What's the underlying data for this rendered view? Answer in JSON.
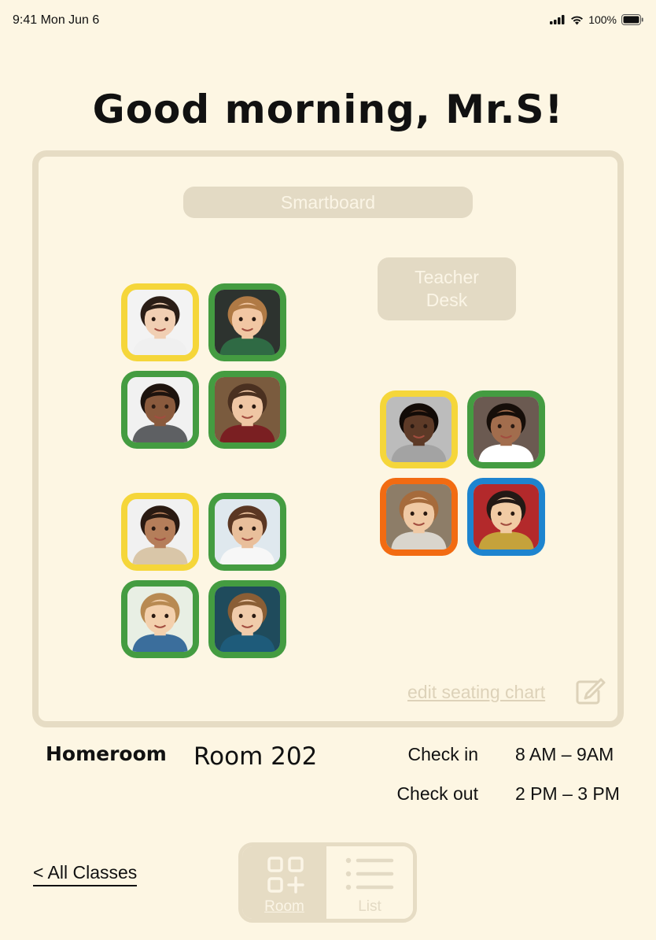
{
  "status_bar": {
    "time": "9:41  Mon Jun 6",
    "battery": "100%"
  },
  "greeting": "Good morning, Mr.S!",
  "room": {
    "smartboard_label": "Smartboard",
    "teacher_desk_label": "Teacher Desk",
    "edit_link": "edit seating chart",
    "students": [
      {
        "status_color": "#f5d63a",
        "skin": "#f1cfb3",
        "hair": "#2a1d16",
        "shirt": "#f0f0f0",
        "bg": "#f3f3f3"
      },
      {
        "status_color": "#449c41",
        "skin": "#f2c7a3",
        "hair": "#b07a45",
        "shirt": "#2f6a44",
        "bg": "#2d332f"
      },
      {
        "status_color": "#449c41",
        "skin": "#8a5a3d",
        "hair": "#1d130e",
        "shirt": "#5e6063",
        "bg": "#f1f1f1"
      },
      {
        "status_color": "#449c41",
        "skin": "#efc6a4",
        "hair": "#4a3020",
        "shirt": "#7a1f22",
        "bg": "#7a5b3e"
      },
      {
        "status_color": "#f5d63a",
        "skin": "#b57e5a",
        "hair": "#2a1a12",
        "shirt": "#d9c6a8",
        "bg": "#f1f1f1"
      },
      {
        "status_color": "#449c41",
        "skin": "#e9bf9b",
        "hair": "#5b3723",
        "shirt": "#f7f7f7",
        "bg": "#dfe8ee"
      },
      {
        "status_color": "#449c41",
        "skin": "#f3d0ad",
        "hair": "#b88a52",
        "shirt": "#3b6e9c",
        "bg": "#e8efe4"
      },
      {
        "status_color": "#449c41",
        "skin": "#f0cbaa",
        "hair": "#8a5e35",
        "shirt": "#1e5b7a",
        "bg": "#1f4b5c"
      },
      {
        "status_color": "#f5d63a",
        "skin": "#5d3a27",
        "hair": "#120b07",
        "shirt": "#a3a3a3",
        "bg": "#bcbcbc"
      },
      {
        "status_color": "#449c41",
        "skin": "#a26d4d",
        "hair": "#160e09",
        "shirt": "#ffffff",
        "bg": "#6b5a51"
      },
      {
        "status_color": "#f26b12",
        "skin": "#f0c9a4",
        "hair": "#a66b3c",
        "shirt": "#d9d5cd",
        "bg": "#8d7d68"
      },
      {
        "status_color": "#1d84cf",
        "skin": "#f1cba4",
        "hair": "#231915",
        "shirt": "#c5a23b",
        "bg": "#b3292b"
      }
    ]
  },
  "info": {
    "homeroom_label": "Homeroom",
    "room_number": "Room 202",
    "check_in_label": "Check in",
    "check_in_time": "8 AM – 9AM",
    "check_out_label": "Check out",
    "check_out_time": "2 PM – 3 PM"
  },
  "nav": {
    "all_classes": "< All Classes",
    "room_tab": "Room",
    "list_tab": "List"
  },
  "colors": {
    "background": "#fdf6e3",
    "panel_border": "#e6dcc4",
    "muted_text": "#ddd2b9"
  }
}
